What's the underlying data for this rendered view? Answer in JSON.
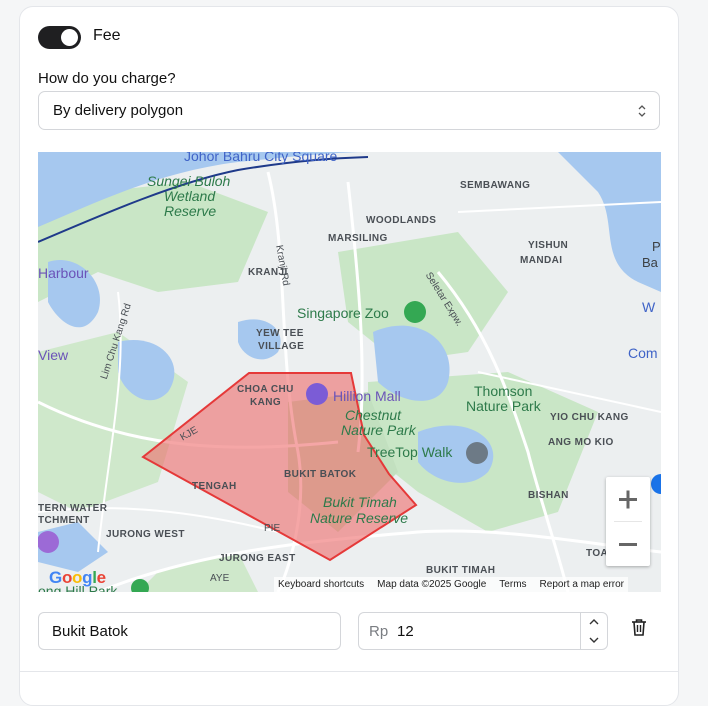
{
  "fee": {
    "label": "Fee",
    "enabled": true
  },
  "charge": {
    "question": "How do you charge?",
    "selected": "By delivery polygon"
  },
  "map": {
    "places": {
      "johor": "Johor Bahru City Square",
      "sungei": "Sungei Buloh",
      "wetland": "Wetland",
      "reserve": "Reserve",
      "harbour": "Harbour",
      "view": "View",
      "kranji": "KRANJI",
      "kranji_rd": "Kranji Rd",
      "lim_chu_kang": "Lim Chu Kang Rd",
      "yew_tee": "YEW TEE",
      "village": "VILLAGE",
      "sembawang": "SEMBAWANG",
      "woodlands": "WOODLANDS",
      "marsiling": "MARSILING",
      "yishun": "YISHUN",
      "mandai": "MANDAI",
      "seletar": "Seletar Expw.",
      "zoo": "Singapore Zoo",
      "choa_chu": "CHOA CHU",
      "kang": "KANG",
      "hillion": "Hillion Mall",
      "chestnut": "Chestnut",
      "nature_park": "Nature Park",
      "thomson": "Thomson",
      "thomson_np": "Nature Park",
      "yio_chu_kang": "YIO CHU KANG",
      "ang_mo_kio": "ANG MO KIO",
      "treetop": "TreeTop Walk",
      "kje": "KJE",
      "tengah": "TENGAH",
      "bukit_batok": "BUKIT BATOK",
      "bukit_timah_nr1": "Bukit Timah",
      "bukit_timah_nr2": "Nature Reserve",
      "western_water": "TERN WATER",
      "catchment": "TCHMENT",
      "jurong_west": "JURONG WEST",
      "jurong_east": "JURONG EAST",
      "pie": "PIE",
      "aye": "AYE",
      "bishan": "BISHAN",
      "bukit_timah": "BUKIT TIMAH",
      "toa": "TOA",
      "ong_hill": "ong Hill Park",
      "p_edge": "P",
      "ba_edge": "Ba",
      "w_edge": "W",
      "com_edge": "Com"
    },
    "logo": "Google",
    "attribution": {
      "shortcuts": "Keyboard shortcuts",
      "data": "Map data ©2025 Google",
      "terms": "Terms",
      "report": "Report a map error"
    },
    "zoom_in": "+",
    "zoom_out": "−",
    "polygon_color": "#ef6b6b"
  },
  "zone": {
    "name": "Bukit Batok",
    "currency": "Rp",
    "amount": "12"
  }
}
